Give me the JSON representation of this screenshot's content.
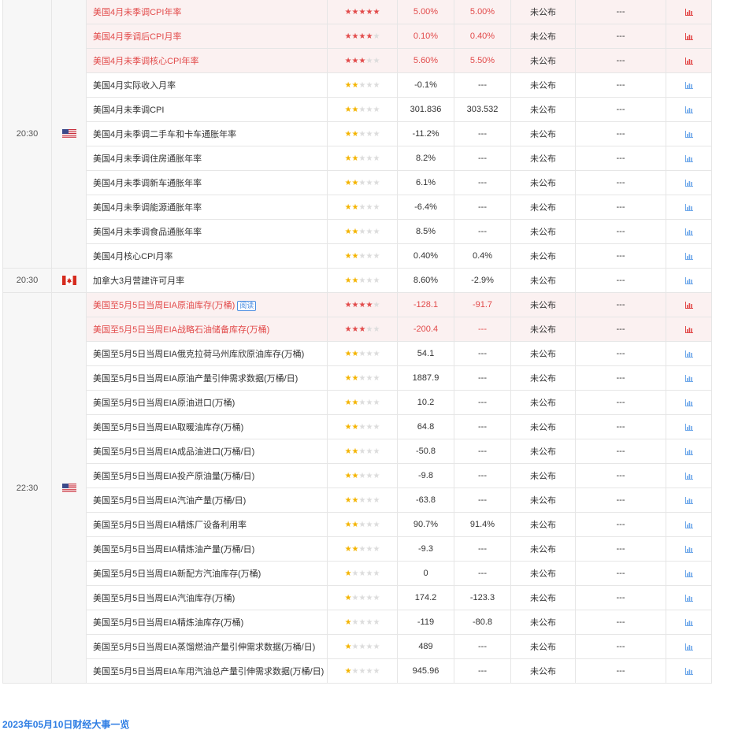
{
  "colors": {
    "important_text": "#e24a4a",
    "star_gold": "#f4b400",
    "link_blue": "#2f7ee4",
    "chart_red": "#e24a4a",
    "chart_blue": "#6fa8ea"
  },
  "groups": [
    {
      "time": "20:30",
      "country": "us",
      "rows": [
        {
          "name": "美国4月未季调CPI年率",
          "stars": 5,
          "important": true,
          "prev": "5.00%",
          "forecast": "5.00%",
          "actual": "未公布",
          "impact": "---"
        },
        {
          "name": "美国4月季调后CPI月率",
          "stars": 4,
          "important": true,
          "prev": "0.10%",
          "forecast": "0.40%",
          "actual": "未公布",
          "impact": "---"
        },
        {
          "name": "美国4月未季调核心CPI年率",
          "stars": 3,
          "important": true,
          "prev": "5.60%",
          "forecast": "5.50%",
          "actual": "未公布",
          "impact": "---"
        },
        {
          "name": "美国4月实际收入月率",
          "stars": 2,
          "important": false,
          "prev": "-0.1%",
          "forecast": "---",
          "actual": "未公布",
          "impact": "---"
        },
        {
          "name": "美国4月未季调CPI",
          "stars": 2,
          "important": false,
          "prev": "301.836",
          "forecast": "303.532",
          "actual": "未公布",
          "impact": "---"
        },
        {
          "name": "美国4月未季调二手车和卡车通胀年率",
          "stars": 2,
          "important": false,
          "prev": "-11.2%",
          "forecast": "---",
          "actual": "未公布",
          "impact": "---"
        },
        {
          "name": "美国4月未季调住房通胀年率",
          "stars": 2,
          "important": false,
          "prev": "8.2%",
          "forecast": "---",
          "actual": "未公布",
          "impact": "---"
        },
        {
          "name": "美国4月未季调新车通胀年率",
          "stars": 2,
          "important": false,
          "prev": "6.1%",
          "forecast": "---",
          "actual": "未公布",
          "impact": "---"
        },
        {
          "name": "美国4月未季调能源通胀年率",
          "stars": 2,
          "important": false,
          "prev": "-6.4%",
          "forecast": "---",
          "actual": "未公布",
          "impact": "---"
        },
        {
          "name": "美国4月未季调食品通胀年率",
          "stars": 2,
          "important": false,
          "prev": "8.5%",
          "forecast": "---",
          "actual": "未公布",
          "impact": "---"
        },
        {
          "name": "美国4月核心CPI月率",
          "stars": 2,
          "important": false,
          "prev": "0.40%",
          "forecast": "0.4%",
          "actual": "未公布",
          "impact": "---"
        }
      ]
    },
    {
      "time": "20:30",
      "country": "ca",
      "rows": [
        {
          "name": "加拿大3月营建许可月率",
          "stars": 2,
          "important": false,
          "prev": "8.60%",
          "forecast": "-2.9%",
          "actual": "未公布",
          "impact": "---"
        }
      ]
    },
    {
      "time": "22:30",
      "country": "us",
      "rows": [
        {
          "name": "美国至5月5日当周EIA原油库存(万桶)",
          "stars": 4,
          "important": true,
          "prev": "-128.1",
          "forecast": "-91.7",
          "actual": "未公布",
          "impact": "---",
          "tag": "阅读"
        },
        {
          "name": "美国至5月5日当周EIA战略石油储备库存(万桶)",
          "stars": 3,
          "important": true,
          "prev": "-200.4",
          "forecast": "---",
          "actual": "未公布",
          "impact": "---"
        },
        {
          "name": "美国至5月5日当周EIA俄克拉荷马州库欣原油库存(万桶)",
          "stars": 2,
          "important": false,
          "prev": "54.1",
          "forecast": "---",
          "actual": "未公布",
          "impact": "---"
        },
        {
          "name": "美国至5月5日当周EIA原油产量引伸需求数据(万桶/日)",
          "stars": 2,
          "important": false,
          "prev": "1887.9",
          "forecast": "---",
          "actual": "未公布",
          "impact": "---"
        },
        {
          "name": "美国至5月5日当周EIA原油进口(万桶)",
          "stars": 2,
          "important": false,
          "prev": "10.2",
          "forecast": "---",
          "actual": "未公布",
          "impact": "---"
        },
        {
          "name": "美国至5月5日当周EIA取暖油库存(万桶)",
          "stars": 2,
          "important": false,
          "prev": "64.8",
          "forecast": "---",
          "actual": "未公布",
          "impact": "---"
        },
        {
          "name": "美国至5月5日当周EIA成品油进口(万桶/日)",
          "stars": 2,
          "important": false,
          "prev": "-50.8",
          "forecast": "---",
          "actual": "未公布",
          "impact": "---"
        },
        {
          "name": "美国至5月5日当周EIA投产原油量(万桶/日)",
          "stars": 2,
          "important": false,
          "prev": "-9.8",
          "forecast": "---",
          "actual": "未公布",
          "impact": "---"
        },
        {
          "name": "美国至5月5日当周EIA汽油产量(万桶/日)",
          "stars": 2,
          "important": false,
          "prev": "-63.8",
          "forecast": "---",
          "actual": "未公布",
          "impact": "---"
        },
        {
          "name": "美国至5月5日当周EIA精炼厂设备利用率",
          "stars": 2,
          "important": false,
          "prev": "90.7%",
          "forecast": "91.4%",
          "actual": "未公布",
          "impact": "---"
        },
        {
          "name": "美国至5月5日当周EIA精炼油产量(万桶/日)",
          "stars": 2,
          "important": false,
          "prev": "-9.3",
          "forecast": "---",
          "actual": "未公布",
          "impact": "---"
        },
        {
          "name": "美国至5月5日当周EIA新配方汽油库存(万桶)",
          "stars": 1,
          "important": false,
          "prev": "0",
          "forecast": "---",
          "actual": "未公布",
          "impact": "---"
        },
        {
          "name": "美国至5月5日当周EIA汽油库存(万桶)",
          "stars": 1,
          "important": false,
          "prev": "174.2",
          "forecast": "-123.3",
          "actual": "未公布",
          "impact": "---"
        },
        {
          "name": "美国至5月5日当周EIA精炼油库存(万桶)",
          "stars": 1,
          "important": false,
          "prev": "-119",
          "forecast": "-80.8",
          "actual": "未公布",
          "impact": "---"
        },
        {
          "name": "美国至5月5日当周EIA蒸馏燃油产量引伸需求数据(万桶/日)",
          "stars": 1,
          "important": false,
          "prev": "489",
          "forecast": "---",
          "actual": "未公布",
          "impact": "---"
        },
        {
          "name": "美国至5月5日当周EIA车用汽油总产量引伸需求数据(万桶/日)",
          "stars": 1,
          "important": false,
          "prev": "945.96",
          "forecast": "---",
          "actual": "未公布",
          "impact": "---"
        }
      ]
    }
  ],
  "footer": {
    "link_text": "2023年05月10日财经大事一览"
  }
}
